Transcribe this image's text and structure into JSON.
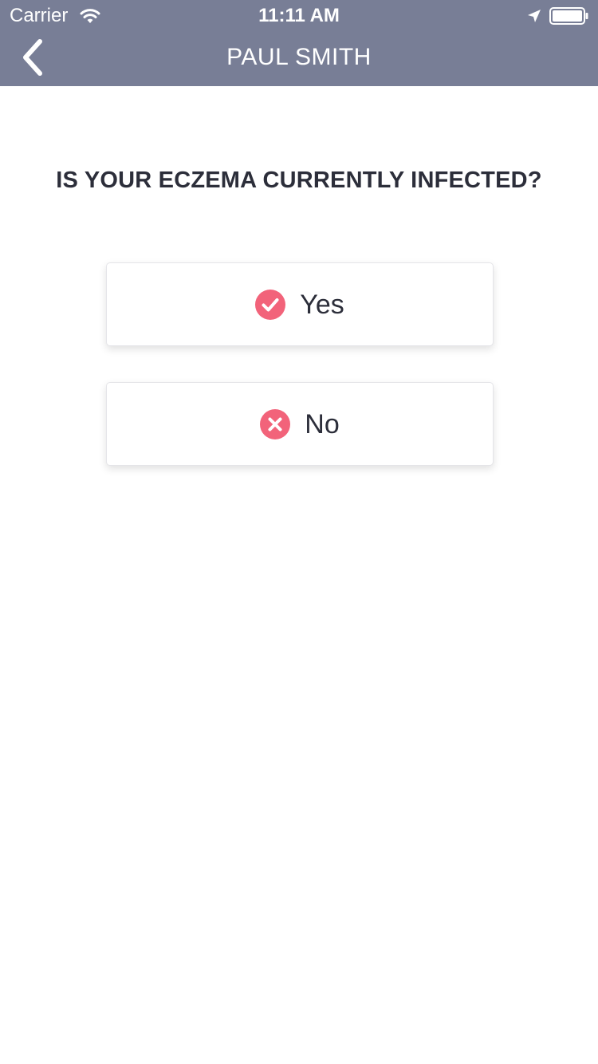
{
  "status_bar": {
    "carrier": "Carrier",
    "time": "11:11 AM",
    "icons": [
      "wifi-icon",
      "location-arrow-icon",
      "battery-icon"
    ]
  },
  "nav": {
    "title": "PAUL SMITH",
    "back_icon": "chevron-left-icon"
  },
  "question": {
    "text": "IS YOUR ECZEMA CURRENTLY INFECTED?"
  },
  "options": [
    {
      "label": "Yes",
      "icon": "check-circle-icon"
    },
    {
      "label": "No",
      "icon": "close-circle-icon"
    }
  ],
  "colors": {
    "header_bg": "#787e96",
    "accent": "#f2637a",
    "text_dark": "#2c2e3a",
    "background": "#ffffff"
  }
}
